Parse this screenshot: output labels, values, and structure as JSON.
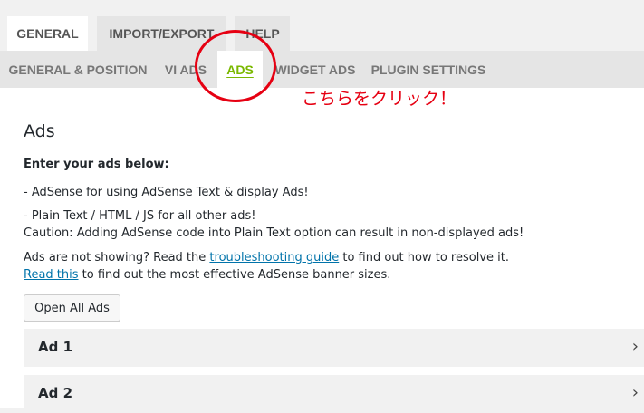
{
  "tabs_top": [
    {
      "label": "GENERAL",
      "active": true
    },
    {
      "label": "IMPORT/EXPORT",
      "active": false
    },
    {
      "label": "HELP",
      "active": false
    }
  ],
  "tabs_sub": [
    {
      "label": "GENERAL & POSITION",
      "active": false
    },
    {
      "label": "VI ADS",
      "active": false
    },
    {
      "label": "ADS",
      "active": true
    },
    {
      "label": "WIDGET ADS",
      "active": false
    },
    {
      "label": "PLUGIN SETTINGS",
      "active": false
    }
  ],
  "annotation": {
    "text": "こちらをクリック！",
    "color": "#e60012"
  },
  "main": {
    "title": "Ads",
    "intro": "Enter your ads below:",
    "line1": "- AdSense for using AdSense Text & display Ads!",
    "line2": "- Plain Text / HTML / JS for all other ads!",
    "line3": "Caution: Adding AdSense code into Plain Text option can result in non-displayed ads!",
    "help_prefix": "Ads are not showing? Read the ",
    "help_link": "troubleshooting guide",
    "help_suffix": " to find out how to resolve it.",
    "read_link": "Read this",
    "read_suffix": " to find out the most effective AdSense banner sizes.",
    "open_all_label": "Open All Ads",
    "ads": [
      {
        "label": "Ad 1"
      },
      {
        "label": "Ad 2"
      }
    ]
  },
  "colors": {
    "accent_active": "#7ab800",
    "link": "#0073aa"
  },
  "icons": {
    "chevron": "chevron-right-icon"
  }
}
